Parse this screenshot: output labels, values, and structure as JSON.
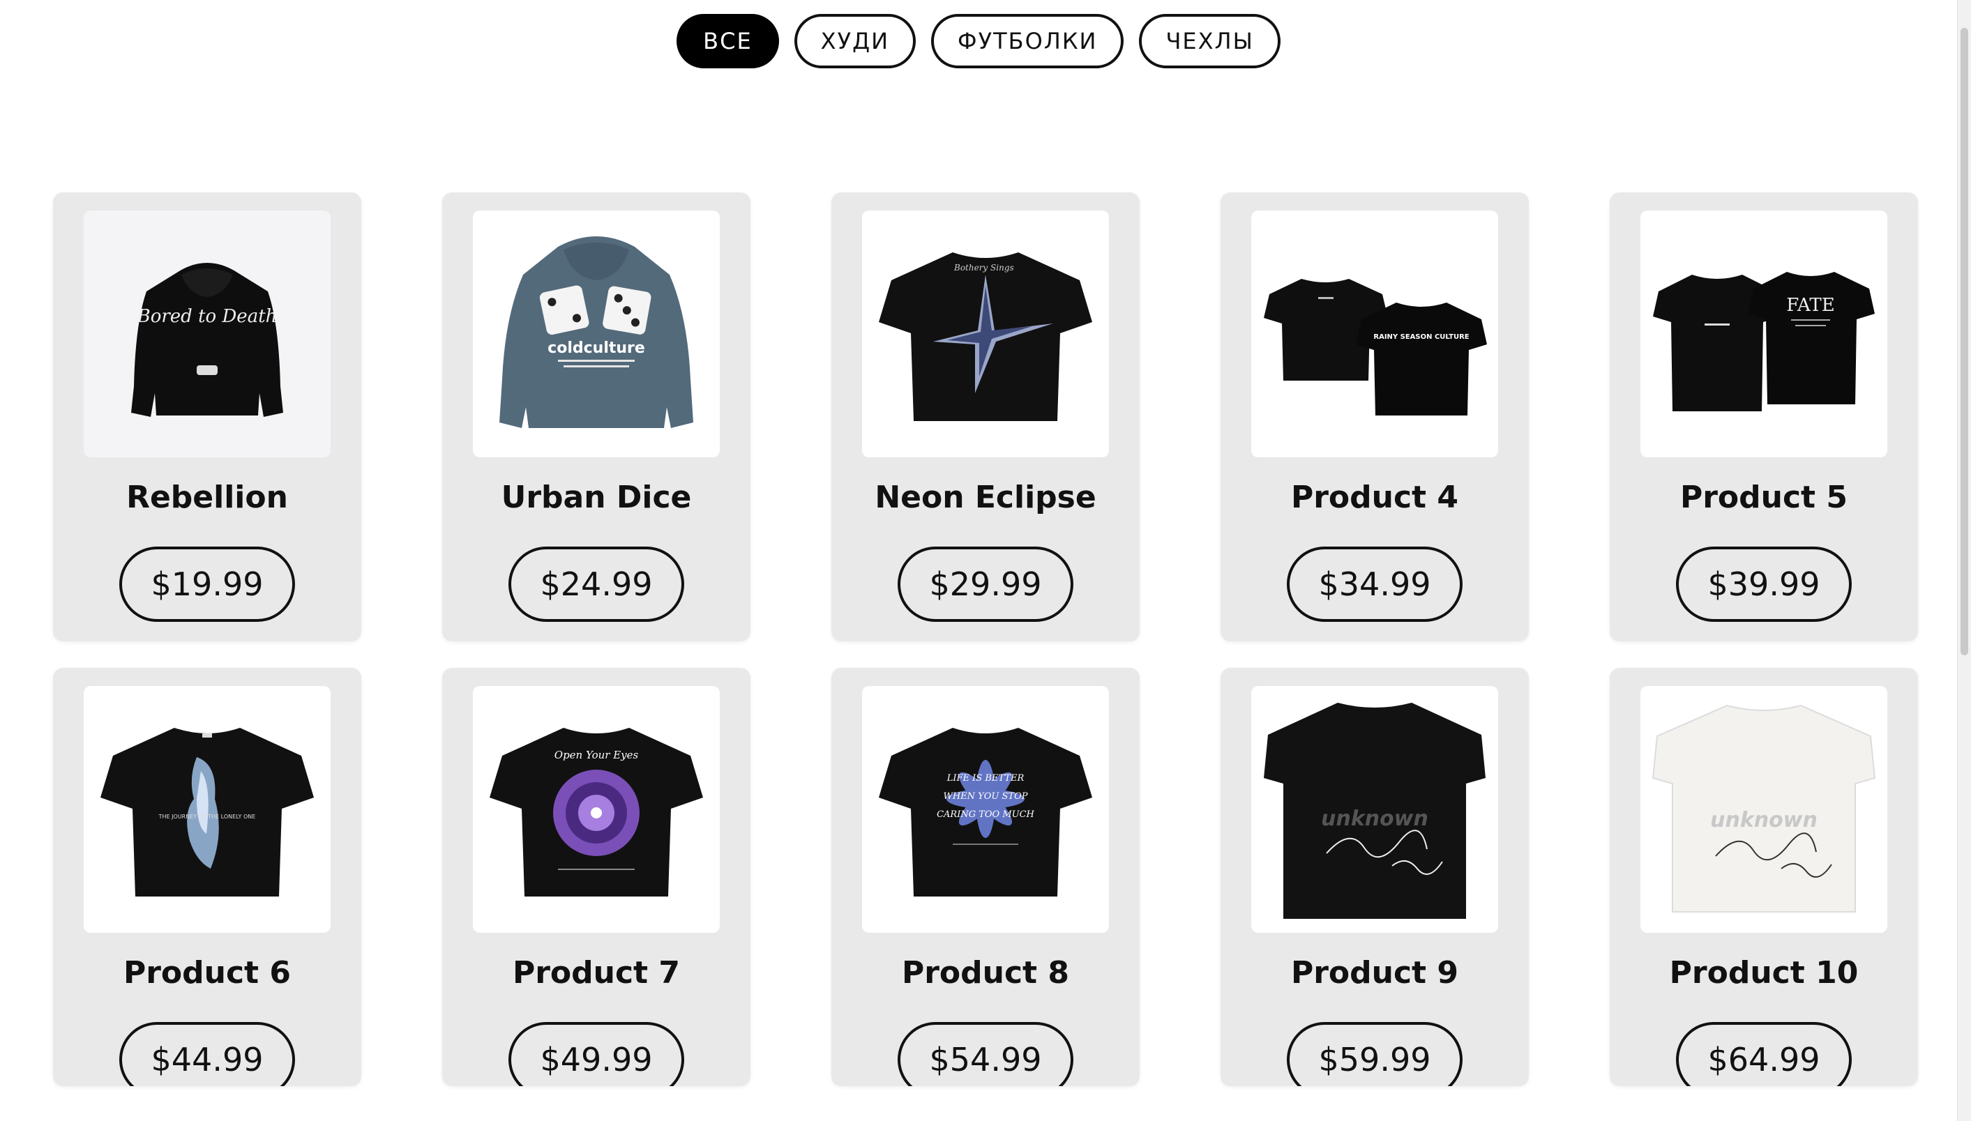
{
  "filters": [
    {
      "label": "ВСЕ",
      "active": true
    },
    {
      "label": "ХУДИ",
      "active": false
    },
    {
      "label": "ФУТБОЛКИ",
      "active": false
    },
    {
      "label": "ЧЕХЛЫ",
      "active": false
    }
  ],
  "products": [
    {
      "name": "Rebellion",
      "price": "$19.99",
      "image": "black-hoodie",
      "print_text": "Bored to Death"
    },
    {
      "name": "Urban Dice",
      "price": "$24.99",
      "image": "slate-hoodie-dice",
      "print_text": "coldculture"
    },
    {
      "name": "Neon Eclipse",
      "price": "$29.99",
      "image": "black-tee-star",
      "print_text": ""
    },
    {
      "name": "Product 4",
      "price": "$34.99",
      "image": "black-tee-pair",
      "print_text": "RAINY SEASON CULTURE"
    },
    {
      "name": "Product 5",
      "price": "$39.99",
      "image": "black-tee-pair-tour",
      "print_text": "FATE"
    },
    {
      "name": "Product 6",
      "price": "$44.99",
      "image": "black-tee-figure",
      "print_text": "THE JOURNEY OF THE LONELY ONE"
    },
    {
      "name": "Product 7",
      "price": "$49.99",
      "image": "black-tee-eye",
      "print_text": "Open Your Eyes"
    },
    {
      "name": "Product 8",
      "price": "$54.99",
      "image": "black-tee-flower",
      "print_text": "LIFE IS BETTER WHEN YOU STOP CARING TOO MUCH"
    },
    {
      "name": "Product 9",
      "price": "$59.99",
      "image": "black-tee-unknown",
      "print_text": "unknown"
    },
    {
      "name": "Product 10",
      "price": "$64.99",
      "image": "white-tee-unknown",
      "print_text": "unknown"
    }
  ],
  "colors": {
    "card_bg": "#e9e9e9",
    "accent": "#000000",
    "slate_hoodie": "#536a7b",
    "purple_print": "#7b4fb8",
    "blue_print": "#6a7fd8"
  }
}
